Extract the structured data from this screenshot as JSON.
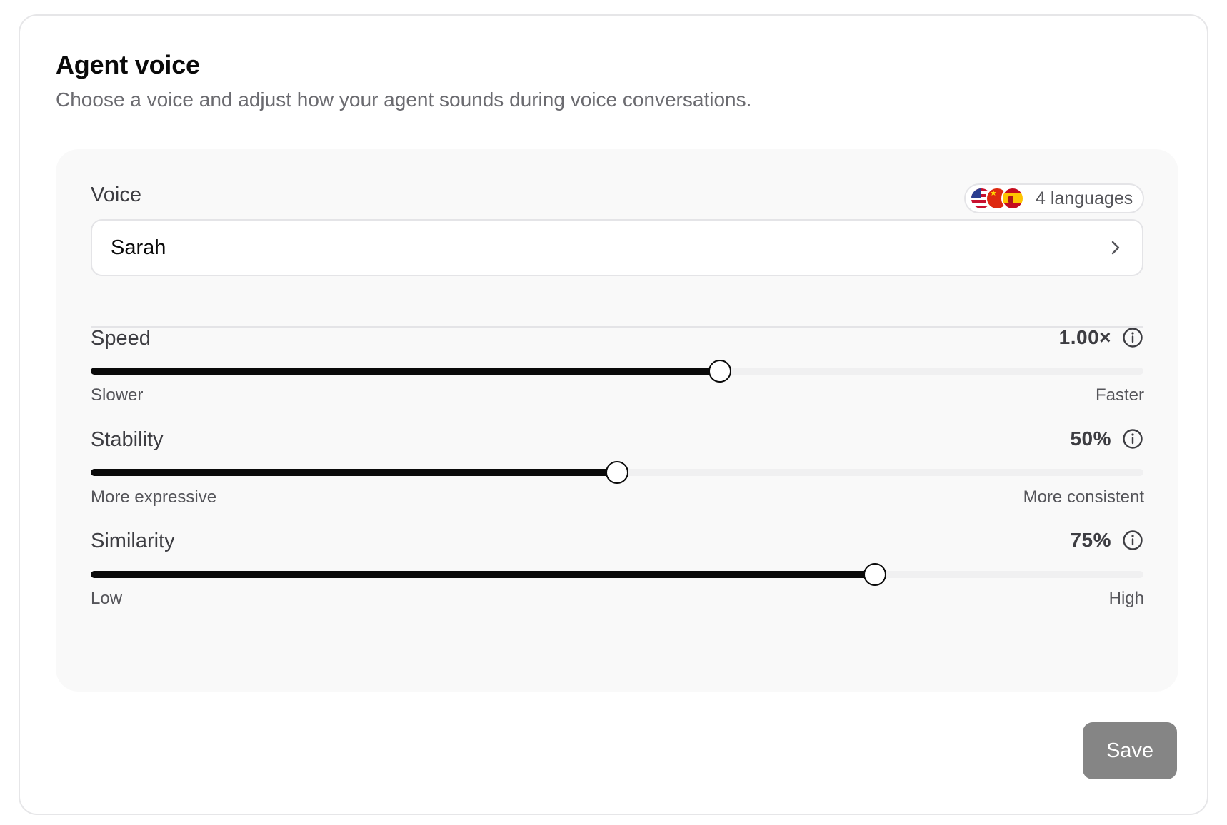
{
  "header": {
    "title": "Agent voice",
    "subtitle": "Choose a voice and adjust how your agent sounds during voice conversations."
  },
  "voice": {
    "label": "Voice",
    "languages_label": "4 languages",
    "flags": [
      "us-flag-icon",
      "china-flag-icon",
      "spain-flag-icon"
    ],
    "selected": "Sarah"
  },
  "sliders": {
    "speed": {
      "label": "Speed",
      "value_text": "1.00×",
      "fraction": 0.598,
      "min_label": "Slower",
      "max_label": "Faster"
    },
    "stability": {
      "label": "Stability",
      "value_text": "50%",
      "fraction": 0.5,
      "min_label": "More expressive",
      "max_label": "More consistent"
    },
    "similarity": {
      "label": "Similarity",
      "value_text": "75%",
      "fraction": 0.745,
      "min_label": "Low",
      "max_label": "High"
    }
  },
  "actions": {
    "save_label": "Save"
  },
  "colors": {
    "accent": "#0a0a0a",
    "panel_bg": "#f9f9f9",
    "save_disabled": "#858585"
  }
}
